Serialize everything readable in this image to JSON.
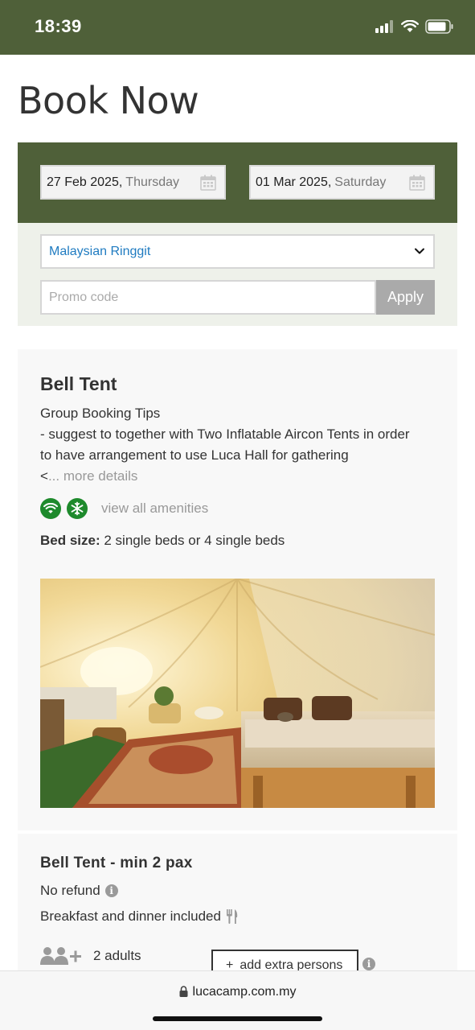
{
  "status_bar": {
    "time": "18:39"
  },
  "page": {
    "title": "Book Now"
  },
  "dates": {
    "checkin_date": "27 Feb 2025,",
    "checkin_day": "Thursday",
    "checkout_date": "01 Mar 2025,",
    "checkout_day": "Saturday"
  },
  "options": {
    "currency": "Malaysian Ringgit",
    "promo_placeholder": "Promo code",
    "promo_value": "",
    "apply_label": "Apply"
  },
  "room": {
    "name": "Bell Tent",
    "description_lines": [
      "Group Booking Tips",
      "- suggest to together with Two Inflatable Aircon Tents in order",
      "to have arrangement to use Luca Hall for gathering"
    ],
    "description_prefix": "<",
    "more_details": "... more details",
    "amenity_icons": [
      "wifi-icon",
      "snowflake-icon"
    ],
    "view_amenities": "view all amenities",
    "bed_size_label": "Bed size:",
    "bed_size_value": "2 single beds or 4 single beds"
  },
  "rate": {
    "name": "Bell Tent - min 2 pax",
    "refund": "No refund",
    "meals": "Breakfast and dinner included",
    "adults": "2 adults",
    "extra_persons_label": "add extra persons"
  },
  "browser": {
    "url": "lucacamp.com.my"
  },
  "colors": {
    "header_green": "#4f6039",
    "panel_tint": "#eef1ea",
    "amenity_green": "#1e8a2c",
    "link_blue": "#1f7bc1",
    "apply_gray": "#aaaaaa"
  }
}
